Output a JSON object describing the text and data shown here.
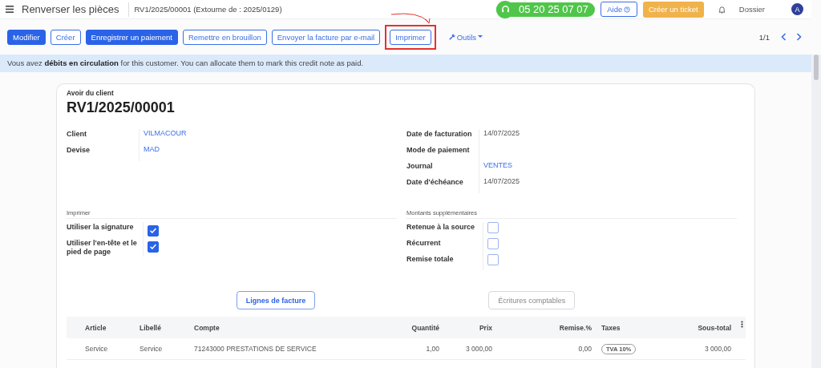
{
  "header": {
    "title": "Renverser les pièces",
    "breadcrumb": "RV1/2025/00001 (Extourne de : 2025/0129)",
    "phone": "05 20 25 07 07",
    "help": "Aide",
    "ticket": "Créer un ticket",
    "company": "Dossier",
    "avatar": "A"
  },
  "actions": [
    {
      "label": "Modifier",
      "kind": "primary",
      "highlighted": false
    },
    {
      "label": "Créer",
      "kind": "secondary",
      "highlighted": false
    },
    {
      "label": "Enregistrer un paiement",
      "kind": "primary",
      "highlighted": false
    },
    {
      "label": "Remettre en brouillon",
      "kind": "secondary",
      "highlighted": false
    },
    {
      "label": "Envoyer la facture par e-mail",
      "kind": "secondary",
      "highlighted": false
    },
    {
      "label": "Imprimer",
      "kind": "secondary",
      "highlighted": true
    }
  ],
  "tools": "Outils",
  "pager": "1/1",
  "alert": "Vous avez **débits en circulation** for this customer. You can allocate them to mark this credit note as paid.",
  "form": {
    "type": "Avoir du client",
    "number": "RV1/2025/00001",
    "left_fields": [
      {
        "label": "Client",
        "value": "VILMACOUR",
        "link": true
      },
      {
        "label": "Devise",
        "value": "MAD",
        "link": true
      }
    ],
    "right_fields": [
      {
        "label": "Date de facturation",
        "value": "14/07/2025",
        "link": false
      },
      {
        "label": "Mode de paiement"
      },
      {
        "label": "Journal",
        "value": "VENTES",
        "link": true
      },
      {
        "label": "Date d'échéance",
        "value": "14/07/2025",
        "link": false
      }
    ],
    "print_section": {
      "title": "Imprimer",
      "options": [
        {
          "label": "Utiliser la signature",
          "checked": true
        },
        {
          "label": "Utiliser l'en-tête et le pied de page",
          "checked": true
        }
      ]
    },
    "extra_section": {
      "title": "Montants supplémentaires",
      "options": [
        {
          "label": "Retenue à la source",
          "checked": false
        },
        {
          "label": "Récurrent",
          "checked": false
        },
        {
          "label": "Remise totale",
          "checked": false
        }
      ]
    }
  },
  "tabs": [
    {
      "label": "Lignes de facture",
      "selected": true
    },
    {
      "label": "Écritures comptables",
      "selected": false
    }
  ],
  "table": {
    "columns": [
      {
        "label": "Article",
        "kind": "text"
      },
      {
        "label": "Libellé",
        "kind": "text"
      },
      {
        "label": "Compte",
        "kind": "text"
      },
      {
        "label": "Quantité",
        "kind": "number"
      },
      {
        "label": "Prix",
        "kind": "number"
      },
      {
        "label": "Remise.%",
        "kind": "number"
      },
      {
        "label": "Taxes",
        "kind": "tag"
      },
      {
        "label": "Sous-total",
        "kind": "number"
      }
    ],
    "rows": [
      {
        "cells": [
          "Service",
          "Service",
          "71243000 PRESTATIONS DE SERVICE",
          "1,00",
          "3 000,00",
          "0,00",
          "TVA 10%",
          "3 000,00"
        ]
      }
    ]
  }
}
